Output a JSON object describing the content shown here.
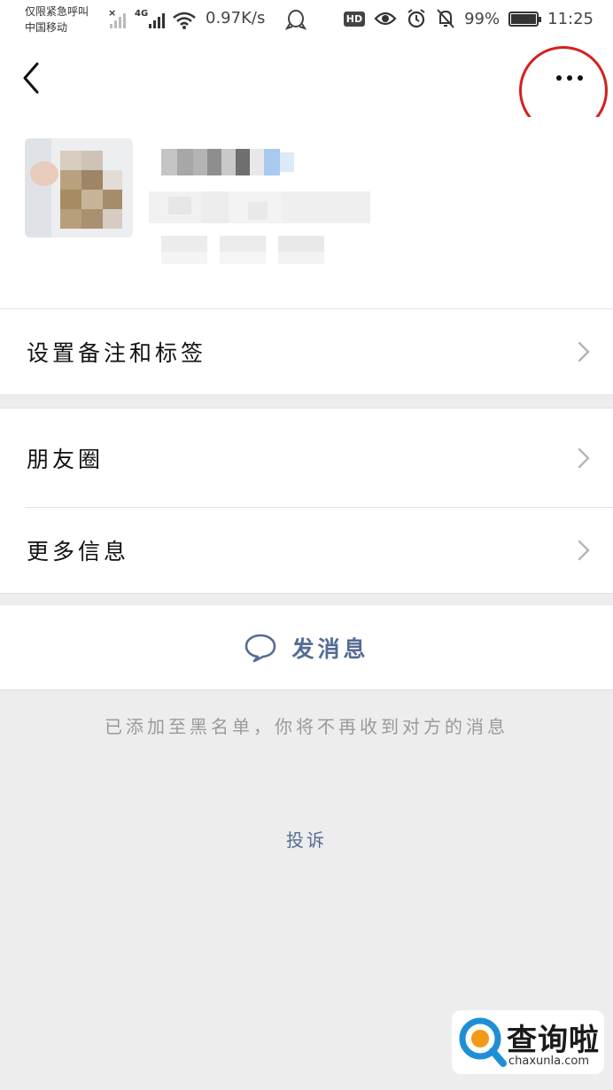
{
  "status_bar": {
    "carrier_line1": "仅限紧急呼叫",
    "carrier_line2": "中国移动",
    "network_tag": "4G",
    "speed": "0.97K/s",
    "hd_badge": "HD",
    "battery_percent": "99%",
    "battery_level": 0.99,
    "time": "11:25",
    "icons": [
      "signal-x-icon",
      "signal-icon",
      "wifi-icon",
      "qq-icon",
      "hd-icon",
      "eye-icon",
      "alarm-icon",
      "mute-bell-icon",
      "battery-icon"
    ]
  },
  "navbar": {
    "back_icon": "chevron-left-icon",
    "more_icon": "more-dots-icon"
  },
  "menu": {
    "set_remark": "设置备注和标签",
    "moments": "朋友圈",
    "more_info": "更多信息"
  },
  "actions": {
    "send_message": "发消息",
    "send_icon": "chat-bubble-icon"
  },
  "notice": "已添加至黑名单，你将不再收到对方的消息",
  "complain": "投诉",
  "watermark": {
    "brand": "查询啦",
    "url": "chaxunla.com"
  },
  "colors": {
    "link_blue": "#566b94",
    "highlight_red": "#d61f1f",
    "background_gray": "#ededed"
  }
}
